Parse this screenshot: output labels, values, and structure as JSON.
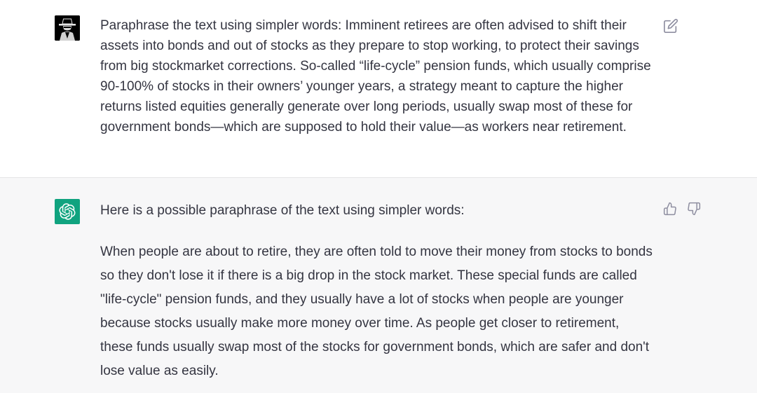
{
  "conversation": {
    "user_message": {
      "avatar": "user-avatar-icon",
      "text": "Paraphrase the text using simpler words: Imminent retirees are often advised to shift their assets into bonds and out of stocks as they prepare to stop working, to protect their savings from big stockmarket corrections. So-called “life-cycle” pension funds, which usually comprise 90-100% of stocks in their owners’ younger years, a strategy meant to capture the higher returns listed equities generally generate over long periods, usually swap most of these for government bonds—which are supposed to hold their value—as workers near retirement.",
      "edit_icon": "edit-icon"
    },
    "assistant_message": {
      "avatar": "openai-logo-icon",
      "intro": "Here is a possible paraphrase of the text using simpler words:",
      "body": "When people are about to retire, they are often told to move their money from stocks to bonds so they don't lose it if there is a big drop in the stock market. These special funds are called \"life-cycle\" pension funds, and they usually have a lot of stocks when people are younger because stocks usually make more money over time. As people get closer to retirement, these funds usually swap most of the stocks for government bonds, which are safer and don't lose value as easily.",
      "thumbs_up_icon": "thumbs-up-icon",
      "thumbs_down_icon": "thumbs-down-icon"
    }
  },
  "colors": {
    "text": "#343541",
    "assistant_bg": "#f7f7f8",
    "brand_green": "#10a37f",
    "icon_gray": "#8e8ea0"
  }
}
